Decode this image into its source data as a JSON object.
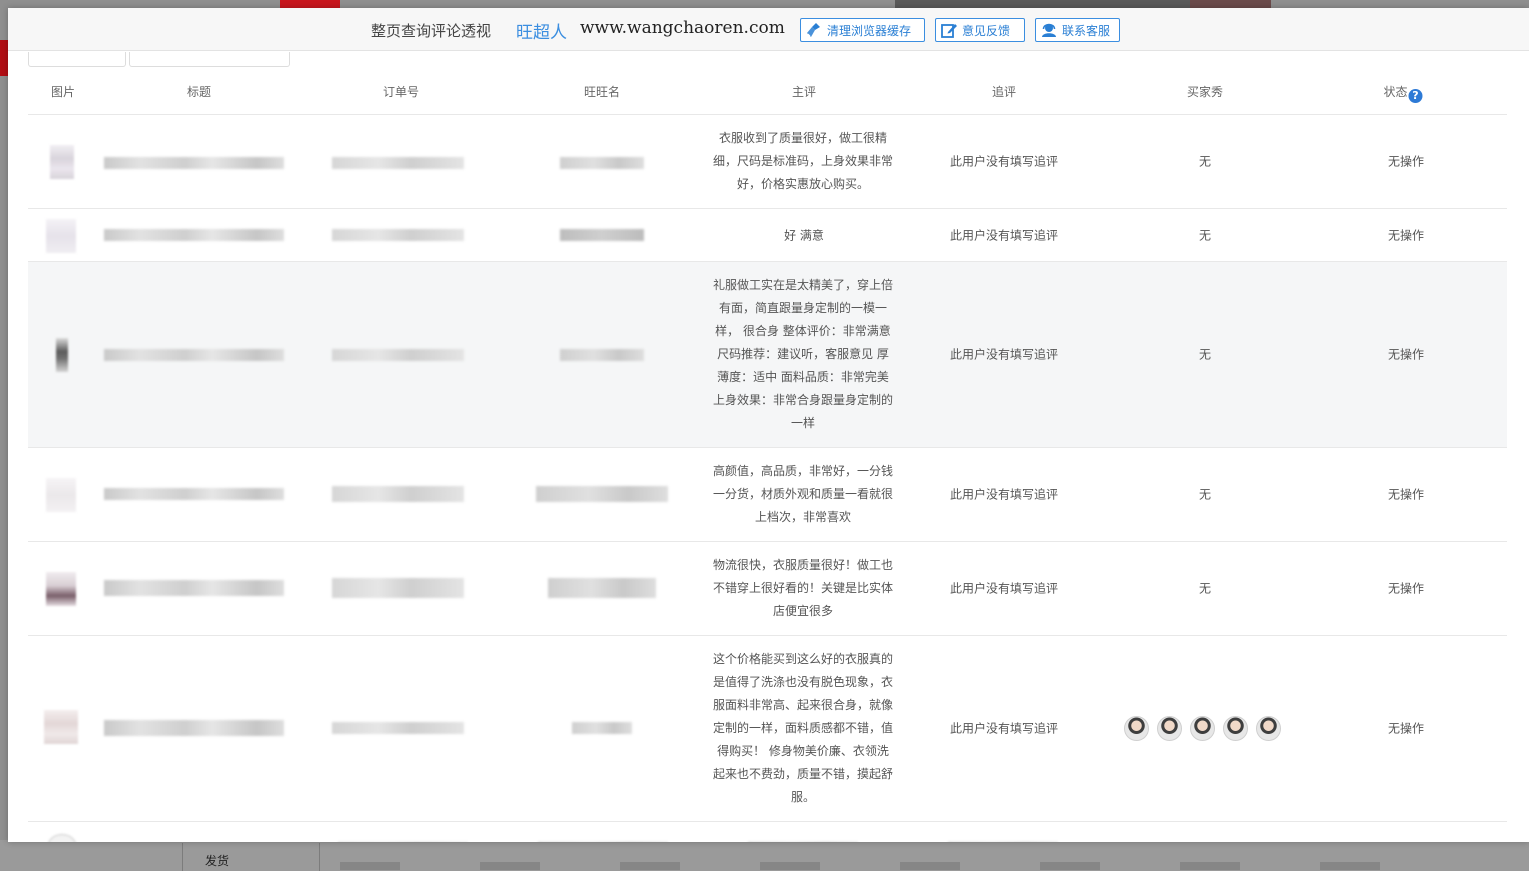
{
  "backdrop": {
    "menu_label": "发货"
  },
  "topbar": {
    "title": "整页查询评论透视",
    "brand": "旺超人",
    "site": "www.wangchaoren.com",
    "buttons": {
      "clear_cache": "清理浏览器缓存",
      "feedback": "意见反馈",
      "customer_service": "联系客服"
    }
  },
  "table": {
    "headers": {
      "image": "图片",
      "title": "标题",
      "order": "订单号",
      "wangwang": "旺旺名",
      "main_review": "主评",
      "followup": "追评",
      "buyer_show": "买家秀",
      "status": "状态",
      "status_help": "?"
    },
    "rows": [
      {
        "main_review_lines": [
          "衣服收到了质量很好，做工很精",
          "细，尺码是标准码，上身效果非常",
          "好，价格实惠放心购买。"
        ],
        "followup": "此用户没有填写追评",
        "buyer_show": "无",
        "status": "无操作"
      },
      {
        "main_review_lines": [
          "好 满意"
        ],
        "followup": "此用户没有填写追评",
        "buyer_show": "无",
        "status": "无操作"
      },
      {
        "main_review_lines": [
          "礼服做工实在是太精美了，穿上倍",
          "有面，简直跟量身定制的一模一",
          "样， 很合身 整体评价：非常满意",
          "尺码推荐：建议听，客服意见 厚",
          "薄度：适中 面料品质：非常完美",
          "上身效果：非常合身跟量身定制的",
          "一样"
        ],
        "followup": "此用户没有填写追评",
        "buyer_show": "无",
        "status": "无操作"
      },
      {
        "main_review_lines": [
          "高颜值，高品质，非常好，一分钱",
          "一分货，材质外观和质量一看就很",
          "上档次，非常喜欢"
        ],
        "followup": "此用户没有填写追评",
        "buyer_show": "无",
        "status": "无操作"
      },
      {
        "main_review_lines": [
          "物流很快，衣服质量很好！做工也",
          "不错穿上很好看的！关键是比实体",
          "店便宜很多"
        ],
        "followup": "此用户没有填写追评",
        "buyer_show": "无",
        "status": "无操作"
      },
      {
        "main_review_lines": [
          "这个价格能买到这么好的衣服真的",
          "是值得了洗涤也没有脱色现象，衣",
          "服面料非常高、起来很合身，就像",
          "定制的一样，面料质感都不错，值",
          "得购买！ 修身物美价廉、衣领洗",
          "起来也不费劲，质量不错，摸起舒",
          "服。"
        ],
        "followup": "此用户没有填写追评",
        "buyer_show_images": 5,
        "status": "无操作"
      }
    ]
  },
  "colors": {
    "accent": "#3b8ee0",
    "help": "#2d7ad6"
  },
  "icons": [
    "broom-icon",
    "edit-icon",
    "headset-icon",
    "help-icon"
  ]
}
